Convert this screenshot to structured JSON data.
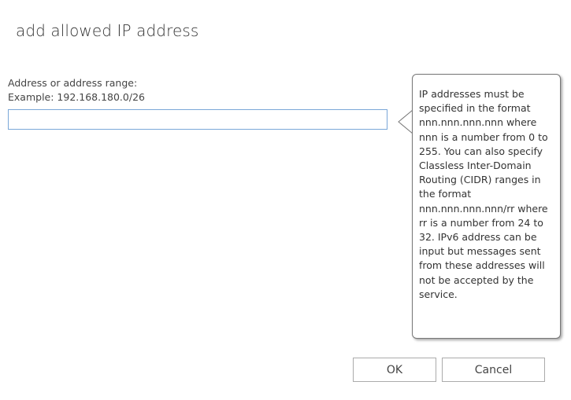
{
  "dialog": {
    "title": "add allowed IP address"
  },
  "address_field": {
    "label": "Address or address range:",
    "example": "Example: 192.168.180.0/26",
    "value": "",
    "placeholder": ""
  },
  "help_callout": {
    "text": "IP addresses must be specified in the format nnn.nnn.nnn.nnn where nnn is a number from 0 to 255. You can also specify Classless Inter-Domain Routing (CIDR) ranges in the format nnn.nnn.nnn.nnn/rr where rr is a number from 24 to 32. IPv6 address can be input but messages sent from these addresses will not be accepted by the service."
  },
  "buttons": {
    "ok_label": "OK",
    "cancel_label": "Cancel"
  },
  "colors": {
    "input_border": "#7aa7d8",
    "button_border": "#ababab",
    "callout_border": "#777777"
  }
}
